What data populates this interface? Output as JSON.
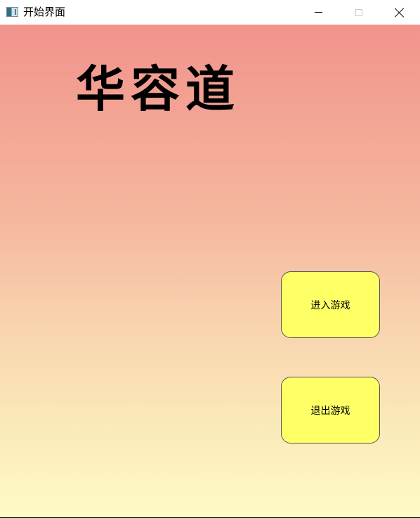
{
  "window": {
    "title": "开始界面"
  },
  "main": {
    "game_title": "华容道",
    "buttons": {
      "start_label": "进入游戏",
      "exit_label": "退出游戏"
    }
  },
  "colors": {
    "background_top": "#f1938c",
    "background_bottom": "#fefbc6",
    "button_fill": "#ffff66"
  },
  "icons": {
    "app": "window-app-icon",
    "minimize": "minimize-icon",
    "maximize": "maximize-icon",
    "close": "close-icon"
  }
}
